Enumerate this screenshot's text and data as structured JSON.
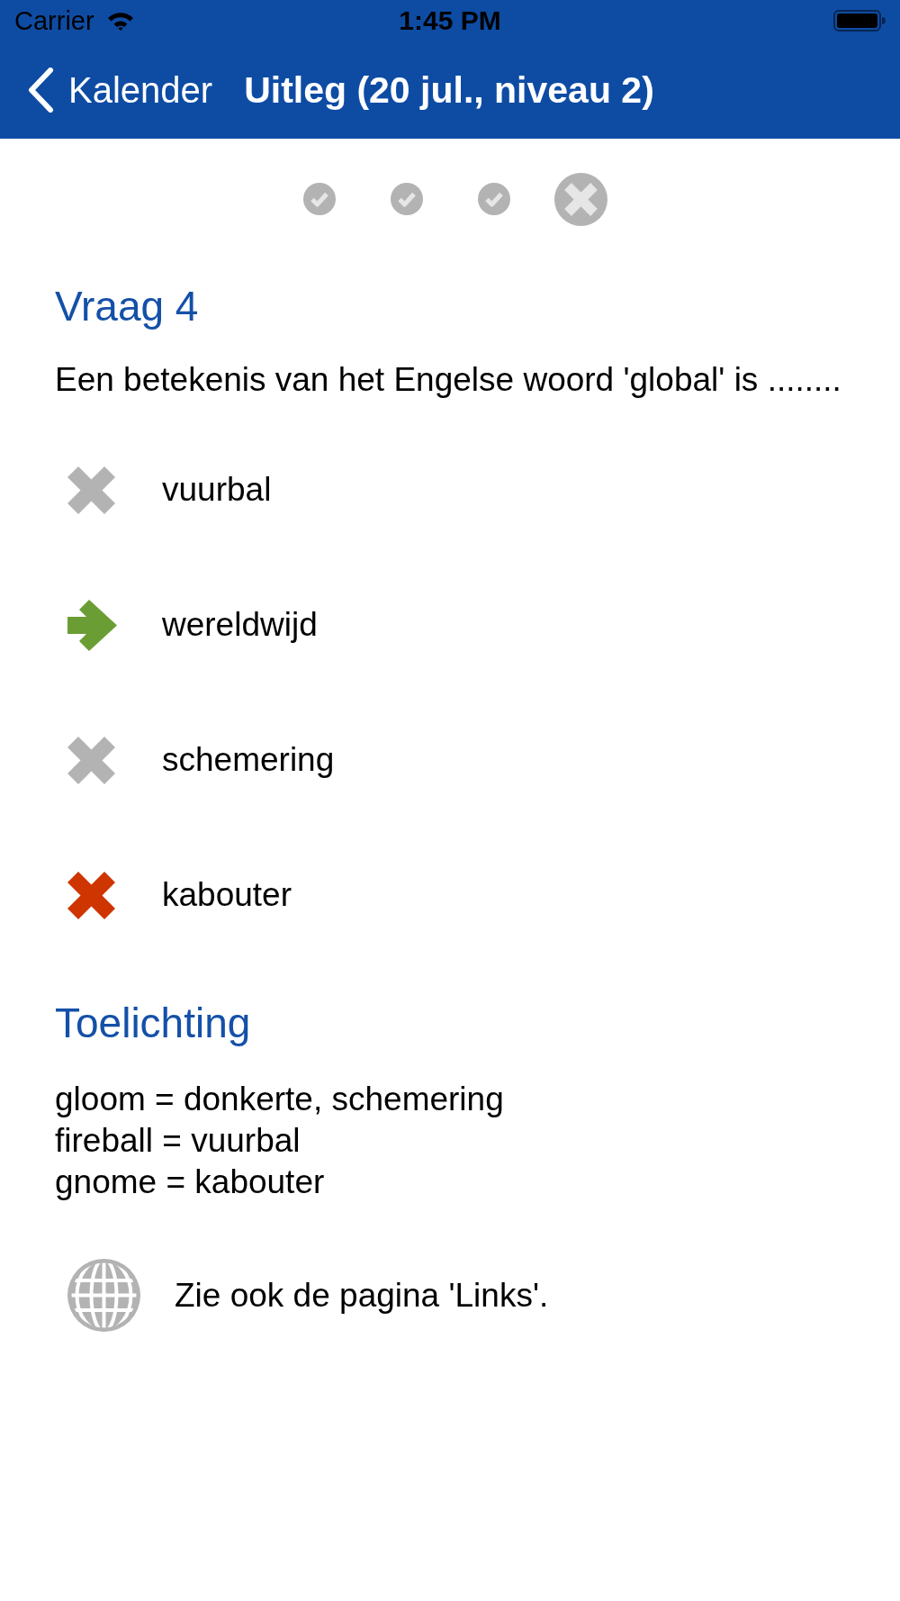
{
  "status_bar": {
    "carrier": "Carrier",
    "time": "1:45 PM"
  },
  "nav_bar": {
    "back": "Kalender",
    "title": "Uitleg (20 jul., niveau 2)"
  },
  "progress": [
    {
      "kind": "correct",
      "selected": false
    },
    {
      "kind": "correct",
      "selected": false
    },
    {
      "kind": "correct",
      "selected": false
    },
    {
      "kind": "wrong",
      "selected": true
    }
  ],
  "question": {
    "heading": "Vraag 4",
    "text": "Een betekenis van het Engelse woord 'global' is ........"
  },
  "answers": [
    {
      "text": "vuurbal",
      "correct": false,
      "selected": false
    },
    {
      "text": "wereldwijd",
      "correct": true,
      "selected": false
    },
    {
      "text": "schemering",
      "correct": false,
      "selected": false
    },
    {
      "text": "kabouter",
      "correct": false,
      "selected": true
    }
  ],
  "explanation": {
    "heading": "Toelichting",
    "lines": [
      "gloom = donkerte, schemering",
      "fireball = vuurbal",
      "gnome = kabouter"
    ]
  },
  "see_also": {
    "text": "Zie ook de pagina 'Links'."
  }
}
